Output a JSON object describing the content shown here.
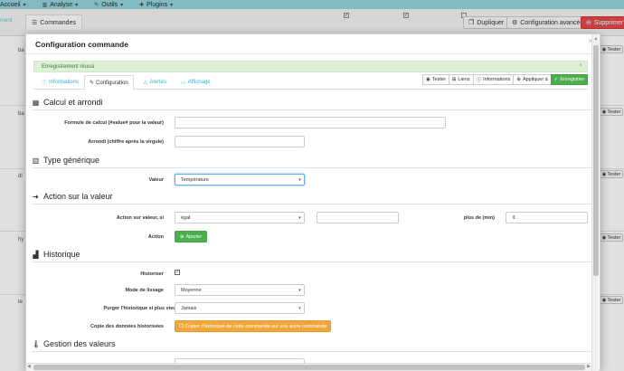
{
  "topnav": {
    "items": [
      {
        "label": "Accueil",
        "icon": "chevron-down-icon"
      },
      {
        "label": "Analyse",
        "icon": "chart-icon"
      },
      {
        "label": "Outils",
        "icon": "wrench-icon"
      },
      {
        "label": "Plugins",
        "icon": "puzzle-icon"
      }
    ]
  },
  "background": {
    "left_tab": "ment",
    "commands_tab": "Commandes",
    "duplicate_label": "Dupliquer",
    "advanced_config_label": "Configuration avancée",
    "delete_label": "Supprimer",
    "row_labels": [
      "ba",
      "ba",
      "dl",
      "hy",
      "te"
    ],
    "tester_label": "Tester"
  },
  "modal": {
    "title": "Configuration commande",
    "close_symbol": "×",
    "alert_text": "Enregistrement réussi",
    "alert_close": "×",
    "tabs": [
      {
        "label": "Informations",
        "icon": "info-icon"
      },
      {
        "label": "Configuration",
        "icon": "wrench-icon"
      },
      {
        "label": "Alertes",
        "icon": "warning-icon"
      },
      {
        "label": "Affichage",
        "icon": "monitor-icon"
      }
    ],
    "actions": {
      "tester": "Tester",
      "liens": "Liens",
      "informations": "Informations",
      "appliquer": "Appliquer à",
      "enregistrer": "Enregistrer"
    },
    "sections": {
      "calcul": {
        "title": "Calcul et arrondi",
        "formula_label": "Formule de calcul (#value# pour la valeur)",
        "formula_value": "",
        "rounding_label": "Arrondi (chiffre après la virgule)",
        "rounding_value": ""
      },
      "type": {
        "title": "Type générique",
        "value_label": "Valeur",
        "value_selected": "Température"
      },
      "action": {
        "title": "Action sur la valeur",
        "condition_label": "Action sur valeur, si",
        "condition_selected": "égal",
        "condition_value": "",
        "duration_label": "plus de (min)",
        "duration_value": "",
        "action_label": "Action",
        "add_label": "Ajouter"
      },
      "historique": {
        "title": "Historique",
        "historize_label": "Historiser",
        "historize_checked": "✓",
        "smoothing_label": "Mode de lissage",
        "smoothing_selected": "Moyenne",
        "purge_label": "Purger l'historique si plus vieux que",
        "purge_selected": "Jamais",
        "copy_label": "Copie des données historisées",
        "copy_button": "Copier l'historique de cette commande sur une autre commande"
      },
      "gestion": {
        "title": "Gestion des valeurs"
      }
    }
  }
}
